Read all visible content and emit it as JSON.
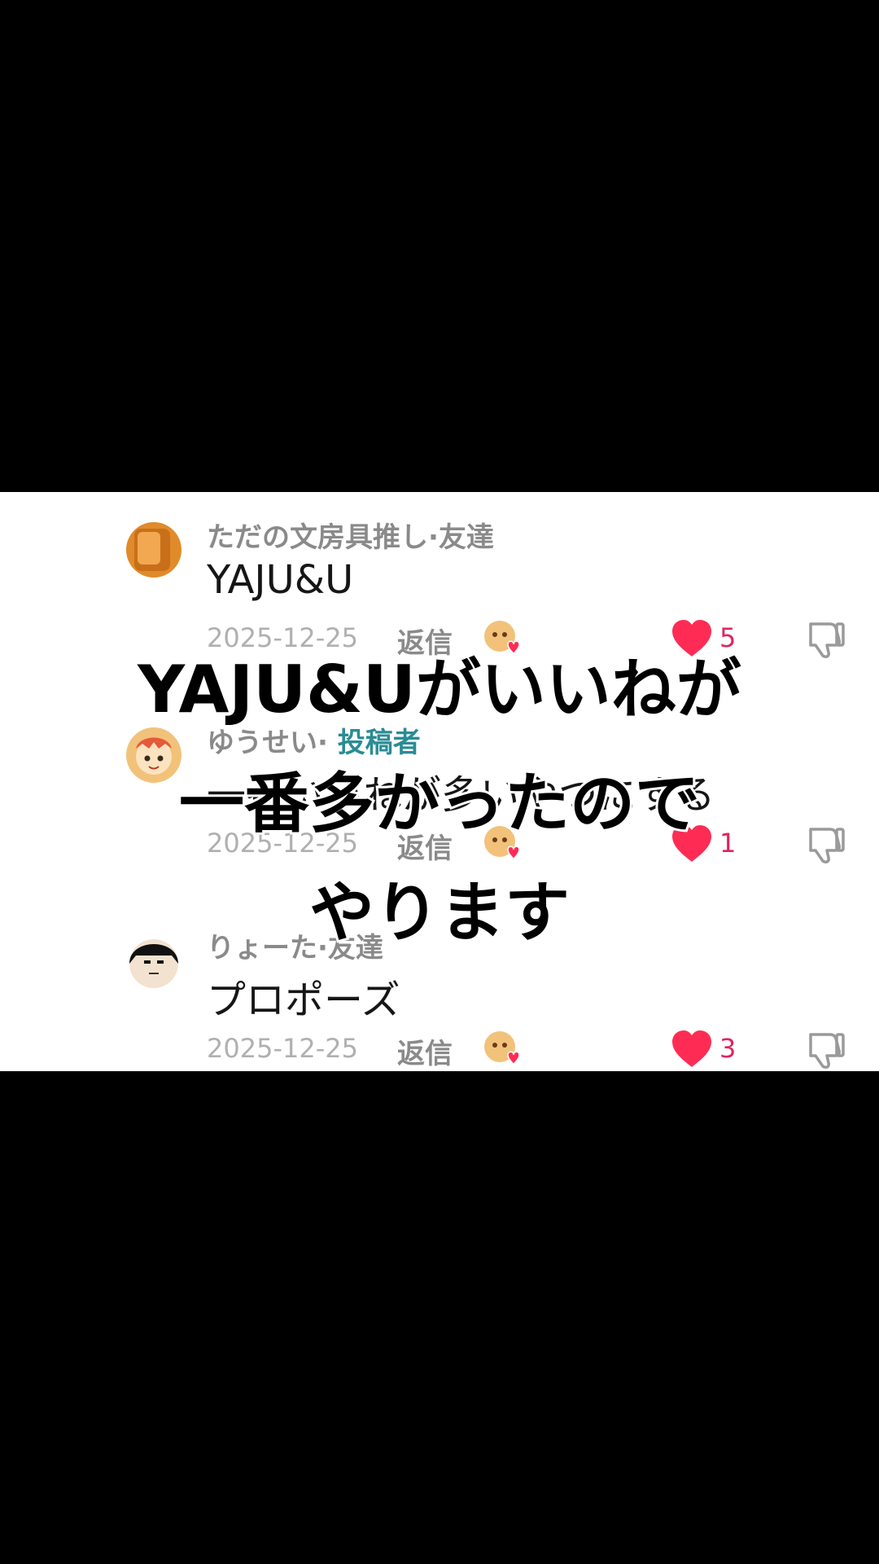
{
  "comments": [
    {
      "author": "ただの文房具推し",
      "separator": "·",
      "relation": "友達",
      "text": "YAJU&U",
      "date": "2025-12-25",
      "reply_label": "返信",
      "likes": "5",
      "avatar_color": "#e08a2a"
    },
    {
      "author": "ゆうせい",
      "separator": "·",
      "relation": "投稿者",
      "text": "一番いいねが多いやつにする",
      "date": "2025-12-25",
      "reply_label": "返信",
      "likes": "1",
      "avatar_color": "#f2c27a"
    },
    {
      "author": "りょーた",
      "separator": "·",
      "relation": "友達",
      "text": "プロポーズ",
      "date": "2025-12-25",
      "reply_label": "返信",
      "likes": "3",
      "avatar_color": "#1a1a1a"
    }
  ],
  "overlay": {
    "line1": "YAJU&Uがいいねが",
    "line2": "一番多かったので",
    "line3": "やります"
  },
  "colors": {
    "like": "#fe2c55",
    "creator_role": "#2a8c94",
    "background": "#ffffff",
    "letterbox": "#000000"
  },
  "icons": {
    "like": "heart-icon",
    "dislike": "thumbs-down-icon",
    "creator_like": "creator-liked-icon"
  }
}
